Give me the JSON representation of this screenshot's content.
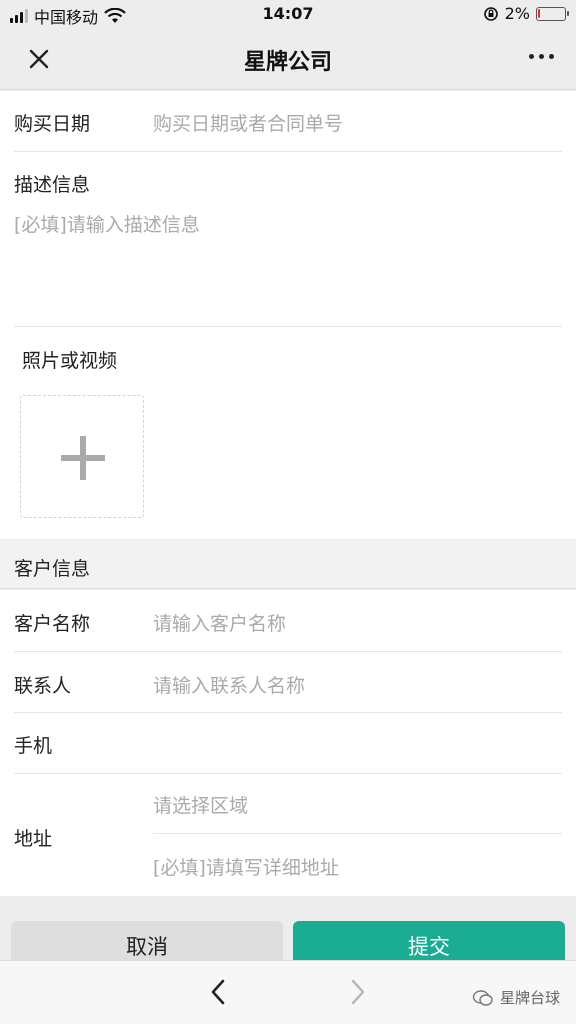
{
  "status_bar": {
    "carrier": "中国移动",
    "time": "14:07",
    "battery_percent": "2%",
    "battery_level": 0.02
  },
  "nav": {
    "title": "星牌公司"
  },
  "form": {
    "purchase_date": {
      "label": "购买日期",
      "placeholder": "购买日期或者合同单号"
    },
    "description": {
      "label": "描述信息",
      "placeholder": "[必填]请输入描述信息"
    },
    "media": {
      "label": "照片或视频"
    },
    "customer_group": {
      "label": "客户信息"
    },
    "customer_name": {
      "label": "客户名称",
      "placeholder": "请输入客户名称"
    },
    "contact": {
      "label": "联系人",
      "placeholder": "请输入联系人名称"
    },
    "phone": {
      "label": "手机"
    },
    "address": {
      "label": "地址",
      "region_placeholder": "请选择区域",
      "detail_placeholder": "[必填]请填写详细地址"
    }
  },
  "buttons": {
    "cancel": "取消",
    "submit": "提交"
  },
  "bottom_bar": {
    "watermark": "星牌台球"
  },
  "colors": {
    "accent": "#1aad94",
    "battery_low": "#e02b2b"
  }
}
